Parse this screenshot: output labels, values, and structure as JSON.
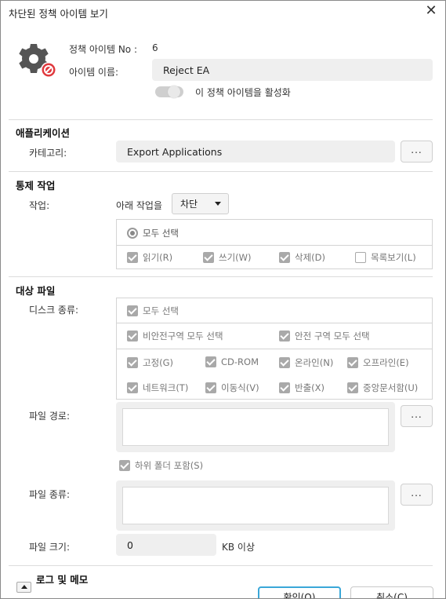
{
  "dialog": {
    "title": "차단된 정책 아이템 보기"
  },
  "header": {
    "item_no_label": "정책 아이템 No :",
    "item_no_value": "6",
    "item_name_label": "아이템 이름:",
    "item_name_value": "Reject EA",
    "activate_label": "이 정책 아이템을 활성화"
  },
  "application": {
    "section_title": "애플리케이션",
    "category_label": "카테고리:",
    "category_value": "Export Applications",
    "browse_label": "..."
  },
  "control": {
    "section_title": "통제 작업",
    "action_label": "작업:",
    "action_prefix": "아래 작업을",
    "action_value": "차단",
    "select_all_label": "모두 선택",
    "options": [
      {
        "label": "읽기(R)",
        "checked": true
      },
      {
        "label": "쓰기(W)",
        "checked": true
      },
      {
        "label": "삭제(D)",
        "checked": true
      },
      {
        "label": "목록보기(L)",
        "checked": false
      }
    ]
  },
  "target": {
    "section_title": "대상 파일",
    "disk_type_label": "디스크 종류:",
    "select_all_label": "모두 선택",
    "non_secure_all_label": "비안전구역 모두 선택",
    "secure_all_label": "안전 구역 모두 선택",
    "disk_options": [
      {
        "label": "고정(G)",
        "checked": true
      },
      {
        "label": "CD-ROM",
        "checked": true
      },
      {
        "label": "온라인(N)",
        "checked": true
      },
      {
        "label": "오프라인(E)",
        "checked": true
      },
      {
        "label": "네트워크(T)",
        "checked": true
      },
      {
        "label": "이동식(V)",
        "checked": true
      },
      {
        "label": "반출(X)",
        "checked": true
      },
      {
        "label": "중앙문서함(U)",
        "checked": true
      }
    ],
    "file_path_label": "파일 경로:",
    "include_subfolders_label": "하위 폴더 포함(S)",
    "file_type_label": "파일 종류:",
    "file_size_label": "파일 크기:",
    "file_size_value": "0",
    "file_size_unit": "KB 이상",
    "browse_label": "..."
  },
  "log": {
    "section_title": "로그 및 메모"
  },
  "footer": {
    "ok_label": "확인(O)",
    "cancel_label": "취소(C)"
  },
  "colors": {
    "accent": "#3aa7d8",
    "field_bg": "#efefef",
    "disabled_check": "#a9a9a9",
    "alert_red": "#e0393e"
  }
}
